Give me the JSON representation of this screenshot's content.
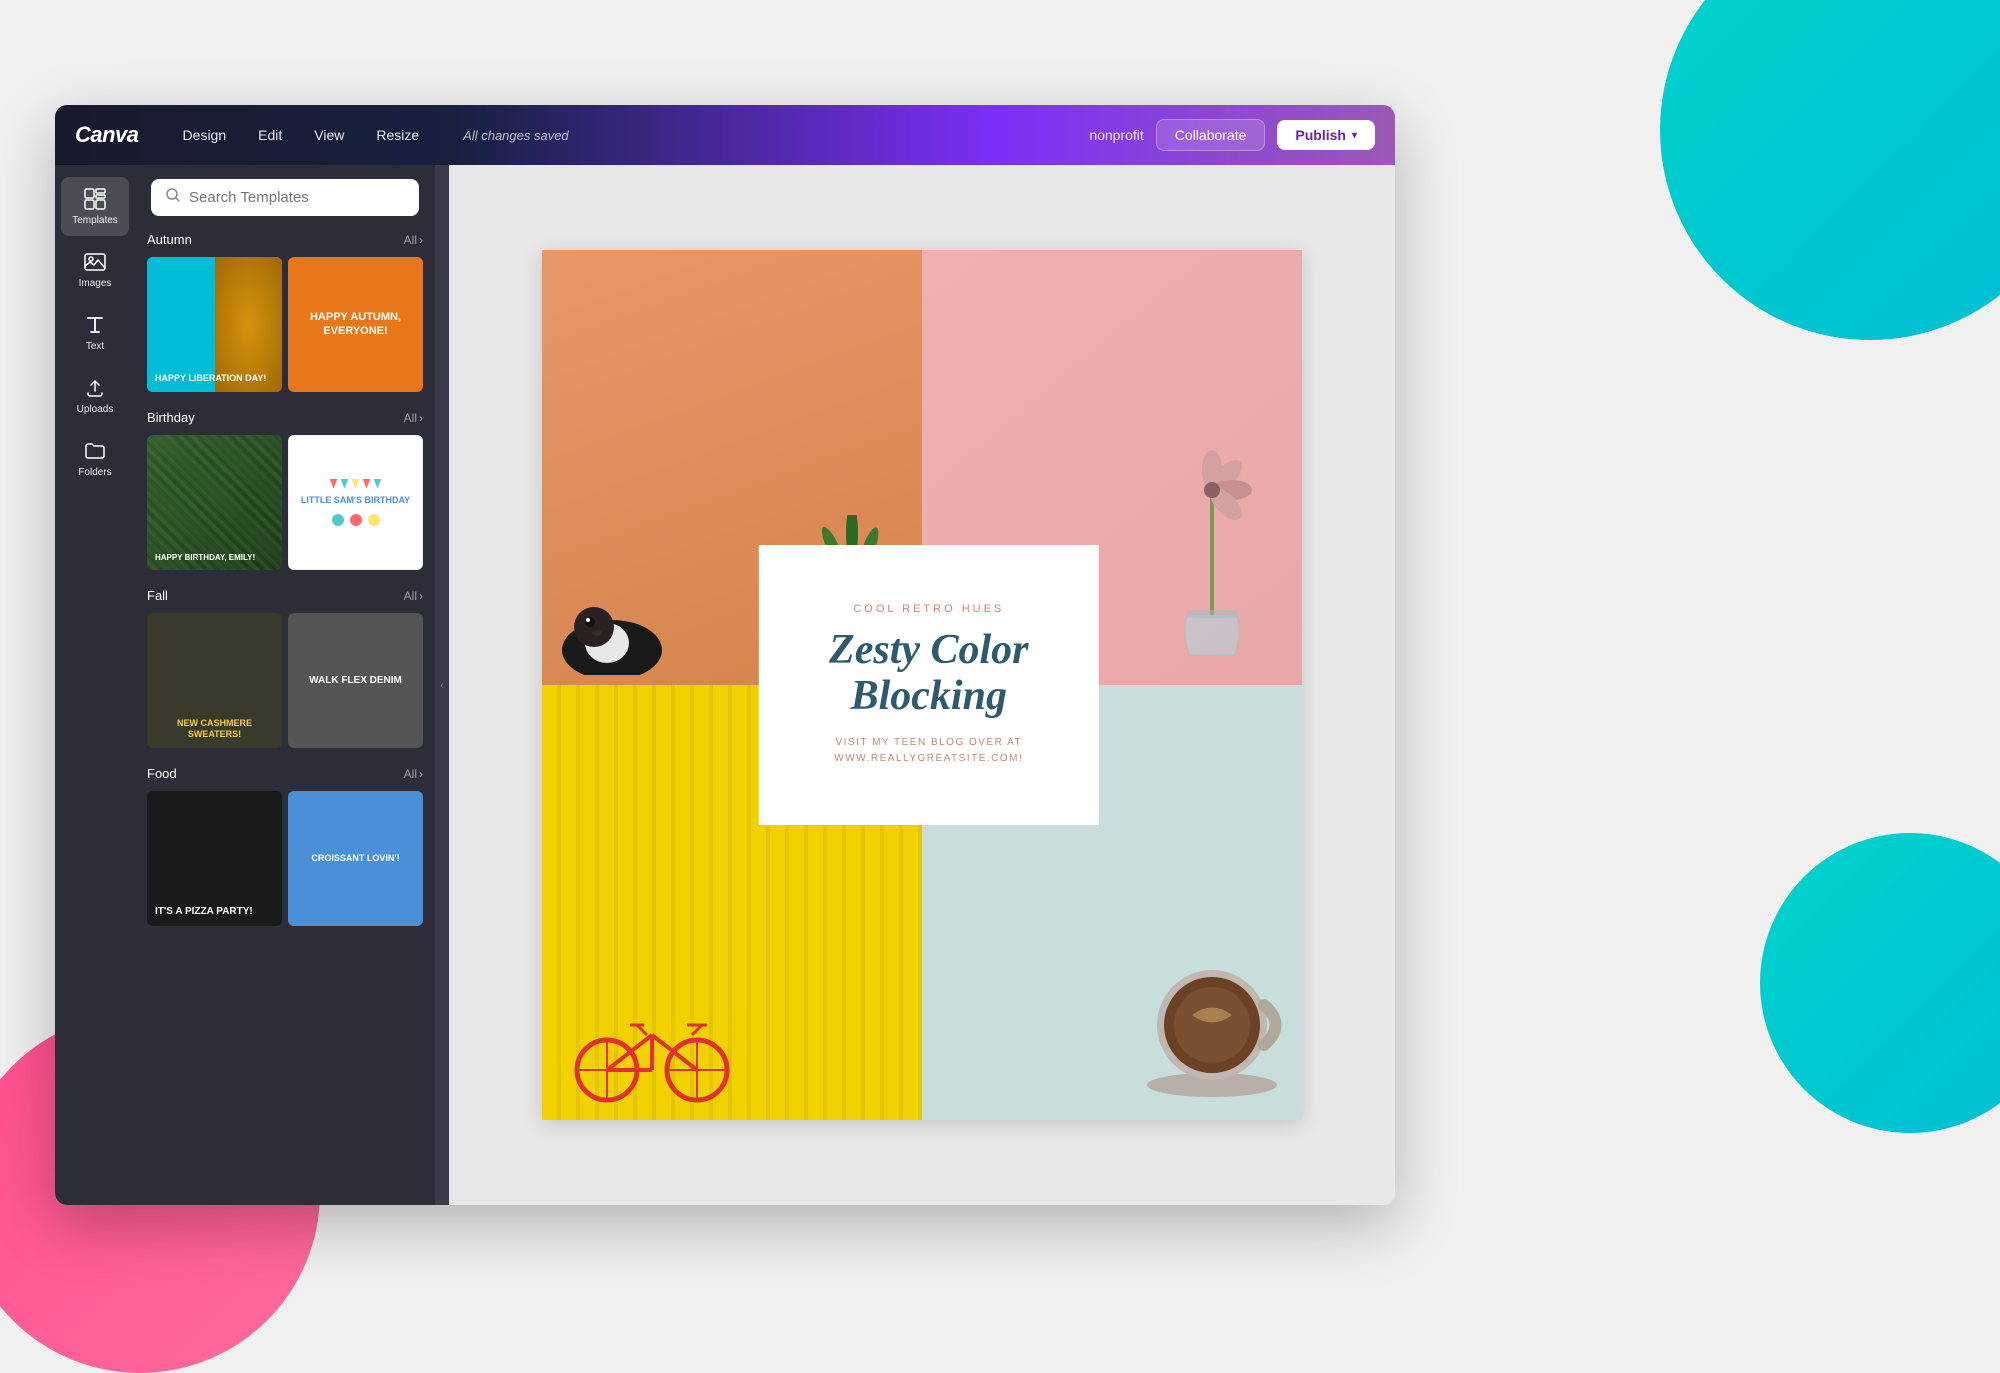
{
  "background": {
    "circleColors": {
      "teal": "#00d4cc",
      "pink": "#ff4d8d"
    }
  },
  "topNav": {
    "logo": "Canva",
    "menuItems": [
      "Design",
      "Edit",
      "View",
      "Resize"
    ],
    "status": "All changes saved",
    "rightItems": {
      "nonprofit": "nonprofit",
      "collaborate": "Collaborate",
      "publish": "Publish"
    }
  },
  "sidebar": {
    "items": [
      {
        "id": "templates",
        "label": "Templates",
        "icon": "⊞",
        "active": true
      },
      {
        "id": "images",
        "label": "Images",
        "icon": "🖼"
      },
      {
        "id": "text",
        "label": "Text",
        "icon": "T"
      },
      {
        "id": "uploads",
        "label": "Uploads",
        "icon": "↑"
      },
      {
        "id": "folders",
        "label": "Folders",
        "icon": "📁"
      }
    ]
  },
  "templatesPanel": {
    "searchPlaceholder": "Search Templates",
    "categories": [
      {
        "name": "Autumn",
        "allLabel": "All",
        "templates": [
          {
            "id": "autumn-1",
            "text": "HAPPY LIBERATION DAY!",
            "bgStyle": "autumn-1"
          },
          {
            "id": "autumn-2",
            "text": "HAPPY AUTUMN, EVERYONE!",
            "bgStyle": "autumn-2"
          }
        ]
      },
      {
        "name": "Birthday",
        "allLabel": "All",
        "templates": [
          {
            "id": "birthday-1",
            "text": "HAPPY BIRTHDAY, EMILY!",
            "bgStyle": "birthday-1"
          },
          {
            "id": "birthday-2",
            "text": "LITTLE SAM'S BIRTHDAY",
            "bgStyle": "birthday-2"
          }
        ]
      },
      {
        "name": "Fall",
        "allLabel": "All",
        "templates": [
          {
            "id": "fall-1",
            "text": "NEW CASHMERE SWEATERS!",
            "bgStyle": "fall-1"
          },
          {
            "id": "fall-2",
            "text": "WALK FLEX DENIM",
            "bgStyle": "fall-2"
          }
        ]
      },
      {
        "name": "Food",
        "allLabel": "All",
        "templates": [
          {
            "id": "food-1",
            "text": "IT'S A PIZZA PARTY!",
            "bgStyle": "food-1"
          },
          {
            "id": "food-2",
            "text": "CROISSANT LOVIN'!",
            "bgStyle": "food-2"
          }
        ]
      }
    ]
  },
  "canvas": {
    "label": "COOL RETRO HUES",
    "title": "Zesty Color Blocking",
    "subtitle": "VISIT MY TEEN BLOG OVER AT",
    "url": "WWW.REALLYGREATSITE.COM!"
  }
}
